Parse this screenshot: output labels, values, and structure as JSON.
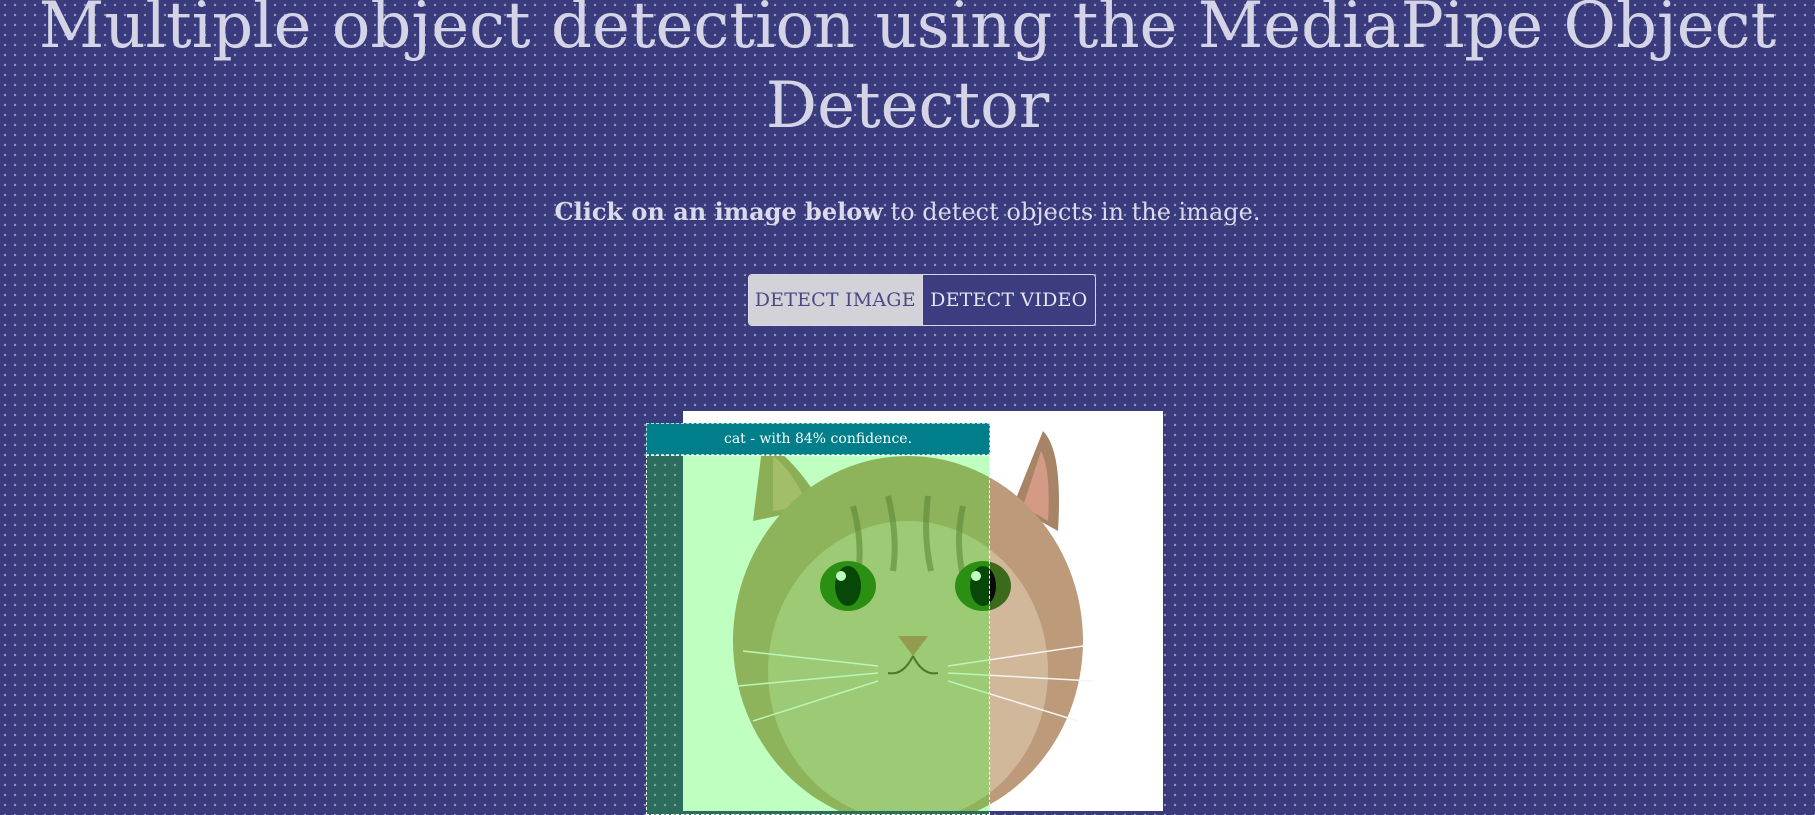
{
  "header": {
    "title": "Multiple object detection using the MediaPipe Object Detector"
  },
  "instructions": {
    "bold": "Click on an image below",
    "rest": " to detect objects in the image."
  },
  "toggle": {
    "image_label": "DETECT IMAGE",
    "video_label": "DETECT VIDEO",
    "active": "DETECT IMAGE"
  },
  "detection": {
    "label": "cat - with 84% confidence."
  },
  "colors": {
    "background": "#3a3b7c",
    "label_bg": "#007f8b",
    "highlight": "rgba(0,255,0,0.25)"
  }
}
